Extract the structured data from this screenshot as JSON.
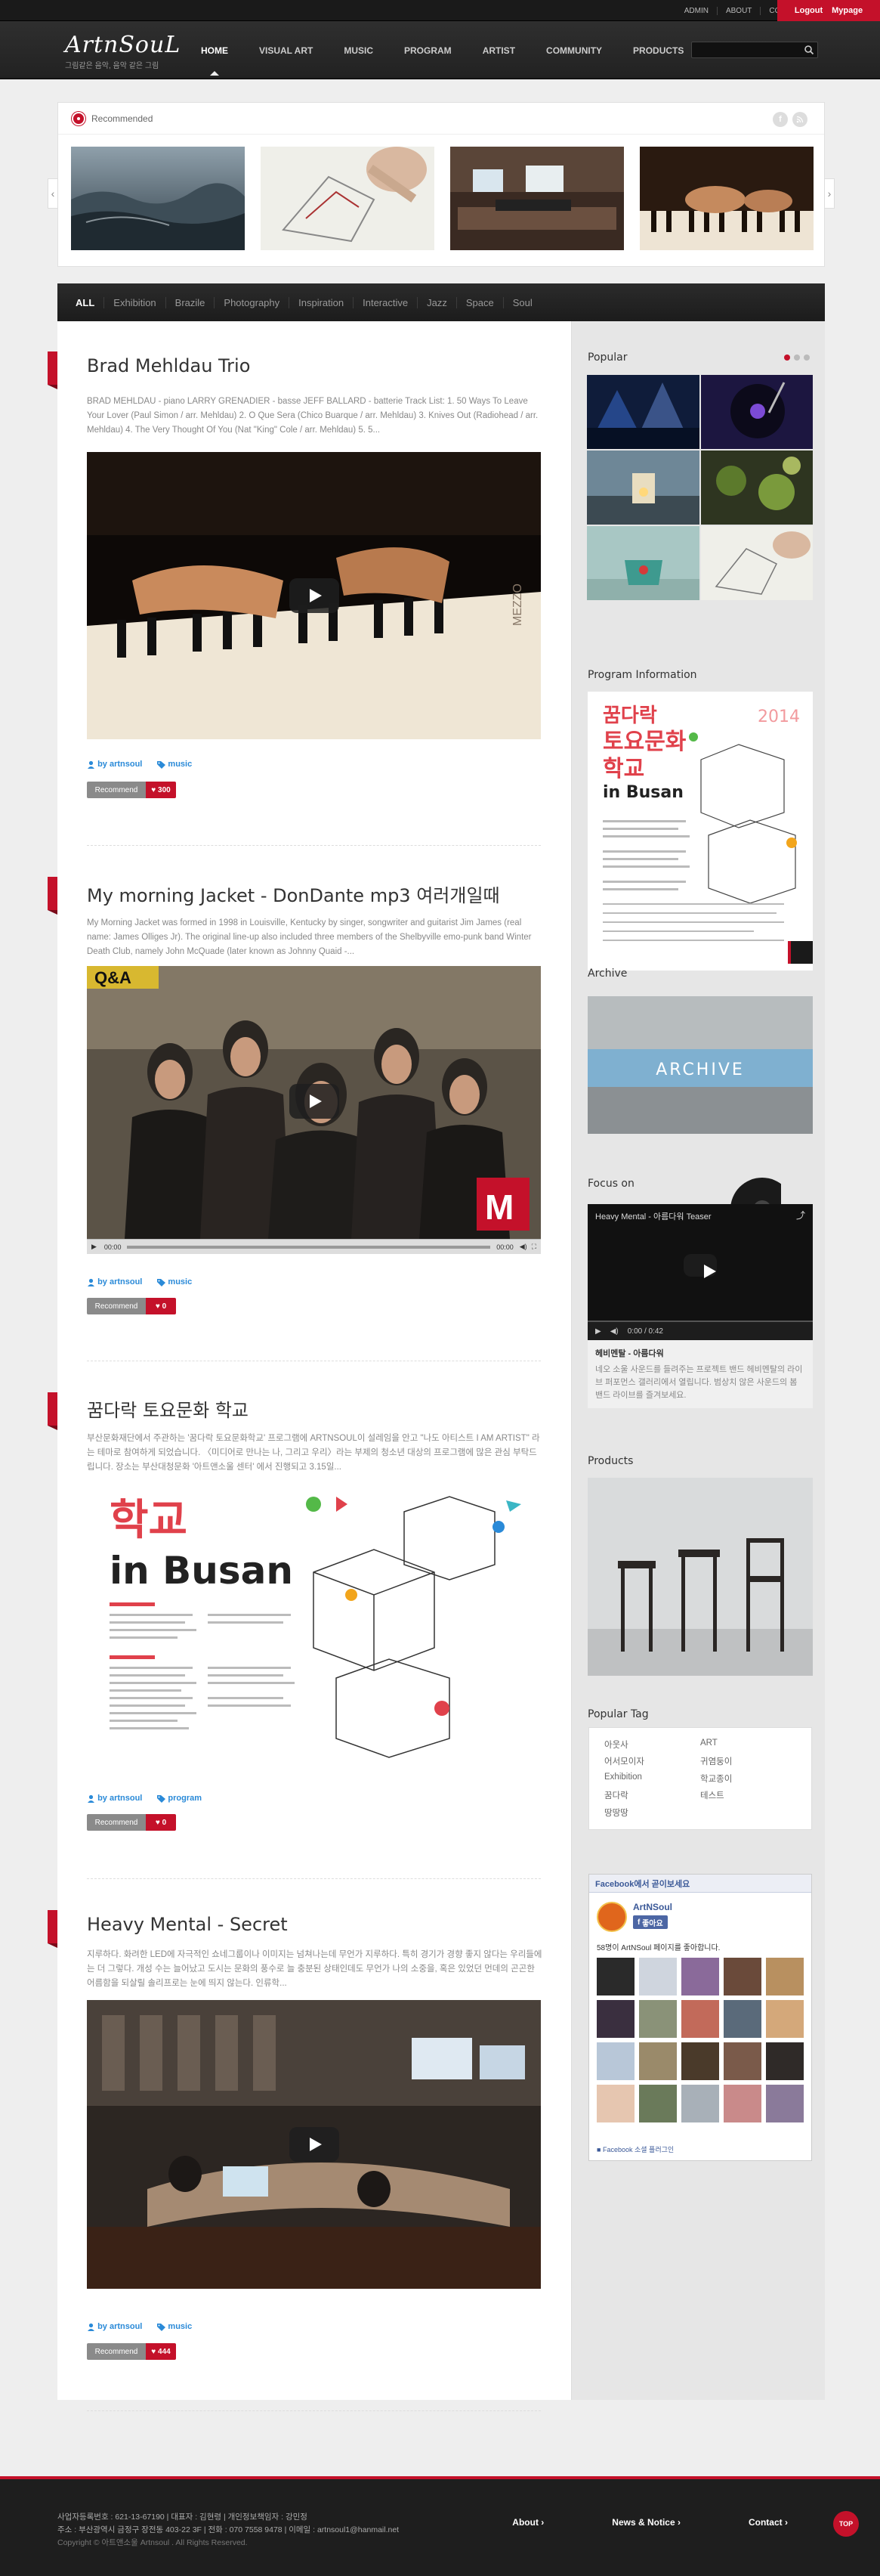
{
  "topbar": {
    "links": [
      "ADMIN",
      "ABOUT",
      "CONTACT"
    ],
    "logout": "Logout",
    "mypage": "Mypage"
  },
  "brand": {
    "logo": "ArtnSouL",
    "tagline": "그림같은 음악, 음악 같은 그림"
  },
  "nav": {
    "items": [
      "HOME",
      "VISUAL ART",
      "MUSIC",
      "PROGRAM",
      "ARTIST",
      "COMMUNITY",
      "PRODUCTS"
    ],
    "active": "HOME",
    "search_placeholder": ""
  },
  "recommended": {
    "title": "Recommended",
    "prev": "‹",
    "next": "›",
    "social": [
      "f",
      "rss"
    ]
  },
  "filters": [
    "ALL",
    "Exhibition",
    "Brazile",
    "Photography",
    "Inspiration",
    "Interactive",
    "Jazz",
    "Space",
    "Soul"
  ],
  "posts": [
    {
      "title": "Brad Mehldau Trio",
      "excerpt": "BRAD MEHLDAU - piano LARRY GRENADIER - basse JEFF BALLARD - batterie Track List: 1. 50 Ways To Leave Your Lover (Paul Simon / arr. Mehldau) 2. O Que Sera (Chico Buarque / arr. Mehldau) 3. Knives Out (Radiohead / arr. Mehldau) 4. The Very Thought Of You (Nat \"King\" Cole / arr. Mehldau) 5. 5...",
      "author": "by artnsoul",
      "category": "music",
      "recommend": "Recommend",
      "likes": "300"
    },
    {
      "title": "My morning Jacket - DonDante mp3 여러개일때",
      "excerpt": "My Morning Jacket was formed in 1998 in Louisville, Kentucky by singer, songwriter and guitarist Jim James (real name: James Olliges Jr). The original line-up also included three members of the Shelbyville emo-punk band Winter Death Club, namely John McQuade (later known as Johnny Quaid -...",
      "author": "by artnsoul",
      "category": "music",
      "recommend": "Recommend",
      "likes": "0",
      "video_time_start": "00:00",
      "video_time_end": "00:00",
      "overlay": "Q&A"
    },
    {
      "title": "꿈다락 토요문화 학교",
      "excerpt": "부산문화재단에서 주관하는 '꿈다락 토요문화학교' 프로그램에 ARTNSOUL이 설레임을 안고 \"나도 아티스트 I AM ARTIST\" 라는 테마로 참여하게 되었습니다. 〈미디어로 만나는 나, 그리고 우리〉라는 부제의 청소년 대상의 프로그램에 많은 관심 부탁드립니다. 장소는 부산대청문화 '아트앤소울 센터' 에서 진행되고 3.15일...",
      "author": "by artnsoul",
      "category": "program",
      "recommend": "Recommend",
      "likes": "0",
      "poster_title_1": "학교",
      "poster_title_2": "in Busan"
    },
    {
      "title": "Heavy Mental - Secret",
      "excerpt": "지루하다. 화려한 LED에 자극적인 쇼네그룹이나 이미지는 넘쳐나는데 무언가 지루하다. 특히 경기가 경향 좋지 않다는 우리들에는 더 그렇다. 개성 수는 늘어났고 도시는 문화의 풍수로 늘 충분된 상태인데도 무언가 나의 소중을, 혹은 있었던 먼데의 곤곤한 어름함을 되살릴 솔리프로는 눈에 띄지 않는다. 인류학...",
      "author": "by artnsoul",
      "category": "music",
      "recommend": "Recommend",
      "likes": "444"
    }
  ],
  "sidebar": {
    "popular": "Popular",
    "program_info": "Program Information",
    "program_poster": {
      "title_1": "꿈다락",
      "title_2": "토요문화",
      "title_3": "학교",
      "title_4": "in Busan",
      "year": "2014"
    },
    "archive": "Archive",
    "archive_label": "ARCHIVE",
    "focus_on": "Focus on",
    "focus_video_title": "Heavy Mental - 아름다워 Teaser",
    "focus_video_time": "0:00 / 0:42",
    "focus_caption_title": "헤비멘탈 - 아름다워",
    "focus_caption_text": "네오 소울 사운드를 들려주는 프로젝트 밴드 헤비멘탈의 라이브 퍼포먼스 갤러리에서 열립니다. 범상치 않은 사운드의 봄 밴드 라이브를 즐겨보세요.",
    "products": "Products",
    "popular_tag": "Popular Tag",
    "tags": [
      "아웃사",
      "ART",
      "어서모이자",
      "귀염둥이",
      "Exhibition",
      "학교종이",
      "꿈다락",
      "테스트",
      "땅땅땅"
    ],
    "fb_title": "Facebook에서 곧이보세요",
    "fb_page": "ArtNSoul",
    "fb_like": "좋아요",
    "fb_count": "58명이 ArtNSoul 페이지를 좋아합니다.",
    "fb_plugin": "Facebook 소셜 플러그인"
  },
  "footer": {
    "line1": "사업자등록번호 : 621-13-67190  |  대표자 : 김현령  |  개인정보책임자 : 강민정",
    "line2": "주소 : 부산광역시 금정구 장전동 403-22 3F  |  전화 : 070 7558 9478  |  이메일 : artnsoul1@hanmail.net",
    "copyright": "Copyright © 아트앤소울 Artnsoul . All Rights Reserved.",
    "nav": [
      "About",
      "News & Notice",
      "Contact"
    ],
    "top": "TOP"
  },
  "colors": {
    "accent": "#c4112a",
    "link": "#2a8ad8",
    "dark": "#222222"
  }
}
